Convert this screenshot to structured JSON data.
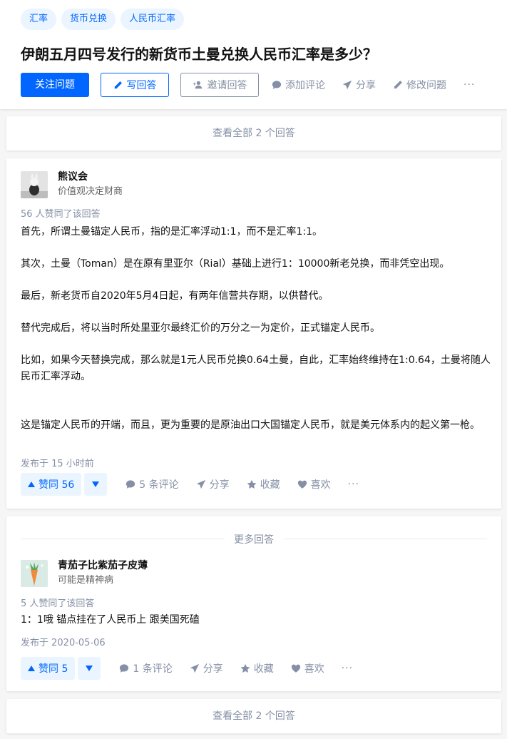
{
  "tags": [
    "汇率",
    "货币兑换",
    "人民币汇率"
  ],
  "question": {
    "title": "伊朗五月四号发行的新货币土曼兑换人民币汇率是多少？",
    "follow_label": "关注问题",
    "write_label": "写回答",
    "invite_label": "邀请回答",
    "comment_label": "添加评论",
    "share_label": "分享",
    "edit_label": "修改问题",
    "more_label": "···"
  },
  "view_all_label": "查看全部 2 个回答",
  "more_answers_label": "更多回答",
  "answers": [
    {
      "author_name": "熊议会",
      "author_bio": "价值观决定财商",
      "votes_text": "56 人赞同了该回答",
      "paragraphs": [
        "首先，所谓土曼锚定人民币，指的是汇率浮动1:1，而不是汇率1:1。",
        "其次，土曼（Toman）是在原有里亚尔（Rial）基础上进行1：10000新老兑换，而非凭空出现。",
        "最后，新老货币自2020年5月4日起，有两年信营共存期，以供替代。",
        "替代完成后，将以当时所处里亚尔最终汇价的万分之一为定价，正式锚定人民币。",
        "比如，如果今天替换完成，那么就是1元人民币兑换0.64土曼，自此，汇率始终维持在1:0.64，土曼将随人民币汇率浮动。",
        "这是锚定人民币的开端，而且，更为重要的是原油出口大国锚定人民币，就是美元体系内的起义第一枪。"
      ],
      "posted": "发布于 15 小时前",
      "upvote_label": "赞同 56",
      "comments_label": "5 条评论",
      "share_label": "分享",
      "collect_label": "收藏",
      "like_label": "喜欢",
      "more_label": "···"
    },
    {
      "author_name": "青茄子比紫茄子皮薄",
      "author_bio": "可能是精神病",
      "votes_text": "5 人赞同了该回答",
      "paragraphs": [
        "1：1哦 锚点挂在了人民币上 跟美国死磕"
      ],
      "posted": "发布于 2020-05-06",
      "upvote_label": "赞同 5",
      "comments_label": "1 条评论",
      "share_label": "分享",
      "collect_label": "收藏",
      "like_label": "喜欢",
      "more_label": "···"
    }
  ],
  "colors": {
    "brand": "#0066ff",
    "muted": "#8590a6",
    "tag_bg": "#ebf5ff"
  }
}
